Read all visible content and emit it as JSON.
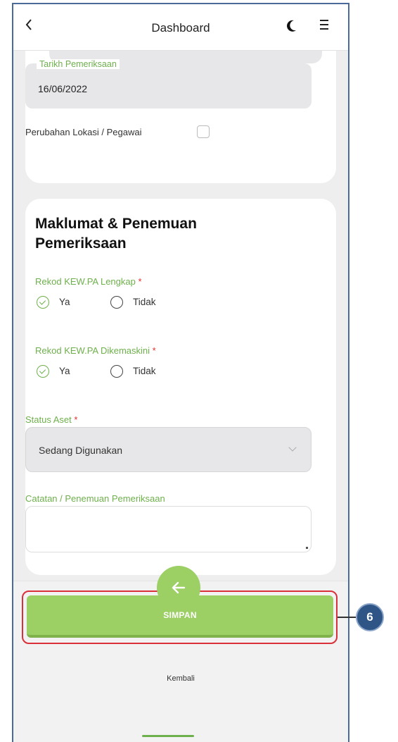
{
  "header": {
    "title": "Dashboard",
    "back_icon": "chevron-left-icon",
    "theme_icon": "moon-icon",
    "menu_icon": "hamburger-menu-icon"
  },
  "form_top": {
    "date_label": "Tarikh Pemeriksaan",
    "date_value": "16/06/2022",
    "location_change_label": "Perubahan Lokasi / Pegawai"
  },
  "findings": {
    "title": "Maklumat & Penemuan Pemeriksaan",
    "required_mark": "*",
    "q1": {
      "label": "Rekod KEW.PA Lengkap",
      "opt_yes": "Ya",
      "opt_no": "Tidak",
      "selected": "Ya"
    },
    "q2": {
      "label": "Rekod KEW.PA Dikemaskini",
      "opt_yes": "Ya",
      "opt_no": "Tidak",
      "selected": "Ya"
    },
    "status_label": "Status Aset",
    "status_value": "Sedang Digunakan",
    "notes_label": "Catatan / Penemuan Pemeriksaan",
    "notes_value": ""
  },
  "actions": {
    "save_label": "SIMPAN",
    "callout_number": "6"
  },
  "bottom_nav": {
    "back_label": "Kembali",
    "back_icon": "arrow-left-icon"
  },
  "colors": {
    "accent": "#9ccf64",
    "label_green": "#6eb04c",
    "required_red": "#e03030",
    "callout_blue": "#2e5586",
    "highlight_red": "#d9303a"
  }
}
